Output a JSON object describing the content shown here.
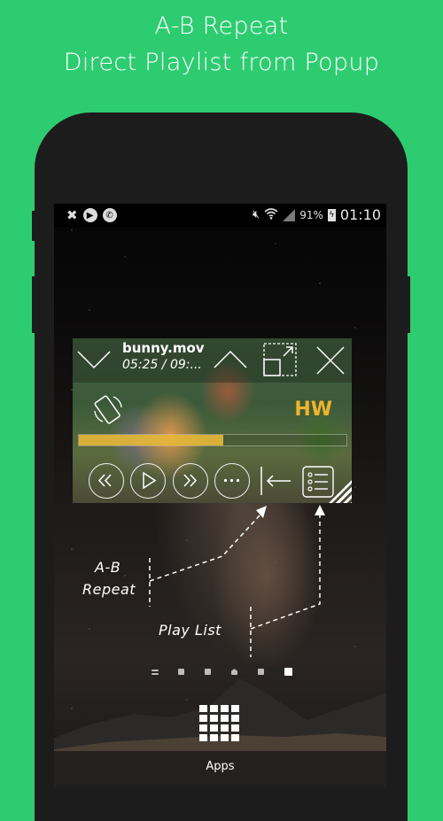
{
  "headline": {
    "line1": "A-B Repeat",
    "line2": "Direct Playlist from Popup"
  },
  "colors": {
    "background": "#2ecc71",
    "phone_body": "#1c1c1c",
    "progress_fill": "#e8b93a",
    "hw_badge": "#f0b429"
  },
  "status_bar": {
    "left_icons": [
      "app-notification-icon",
      "play-icon",
      "phone-icon"
    ],
    "right_icons": [
      "mute-icon",
      "wifi-icon",
      "signal-icon"
    ],
    "battery_percent": "91%",
    "time": "01:10"
  },
  "popup_player": {
    "file_name": "bunny.mov",
    "time": "05:25 / 09:...",
    "hw_badge": "HW",
    "progress": 0.54,
    "controls": [
      "rewind",
      "play",
      "fast-forward",
      "more",
      "ab-repeat",
      "playlist"
    ]
  },
  "annotations": {
    "ab_repeat": "A-B\nRepeat",
    "ab_line1": "A-B",
    "ab_line2": "Repeat",
    "play_list": "Play List"
  },
  "home_screen": {
    "page_indicators": 6,
    "active_page": 5,
    "apps_label": "Apps"
  }
}
